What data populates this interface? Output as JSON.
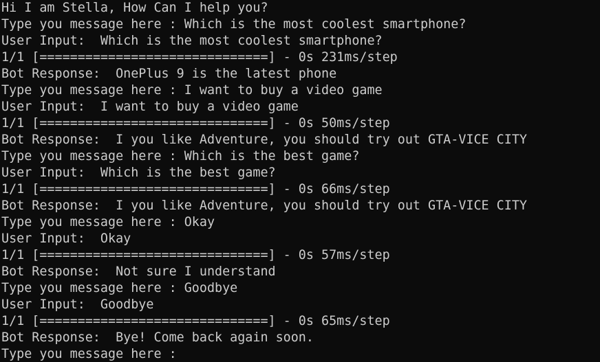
{
  "terminal": {
    "lines": [
      "Hi I am Stella, How Can I help you?",
      "Type you message here : Which is the most coolest smartphone?",
      "User Input:  Which is the most coolest smartphone?",
      "1/1 [==============================] - 0s 231ms/step",
      "Bot Response:  OnePlus 9 is the latest phone",
      "Type you message here : I want to buy a video game",
      "User Input:  I want to buy a video game",
      "1/1 [==============================] - 0s 50ms/step",
      "Bot Response:  I you like Adventure, you should try out GTA-VICE CITY",
      "Type you message here : Which is the best game?",
      "User Input:  Which is the best game?",
      "1/1 [==============================] - 0s 66ms/step",
      "Bot Response:  I you like Adventure, you should try out GTA-VICE CITY",
      "Type you message here : Okay",
      "User Input:  Okay",
      "1/1 [==============================] - 0s 57ms/step",
      "Bot Response:  Not sure I understand",
      "Type you message here : Goodbye",
      "User Input:  Goodbye",
      "1/1 [==============================] - 0s 65ms/step",
      "Bot Response:  Bye! Come back again soon.",
      "Type you message here : "
    ]
  },
  "colors": {
    "background": "#0c0c0c",
    "text": "#cccccc"
  }
}
